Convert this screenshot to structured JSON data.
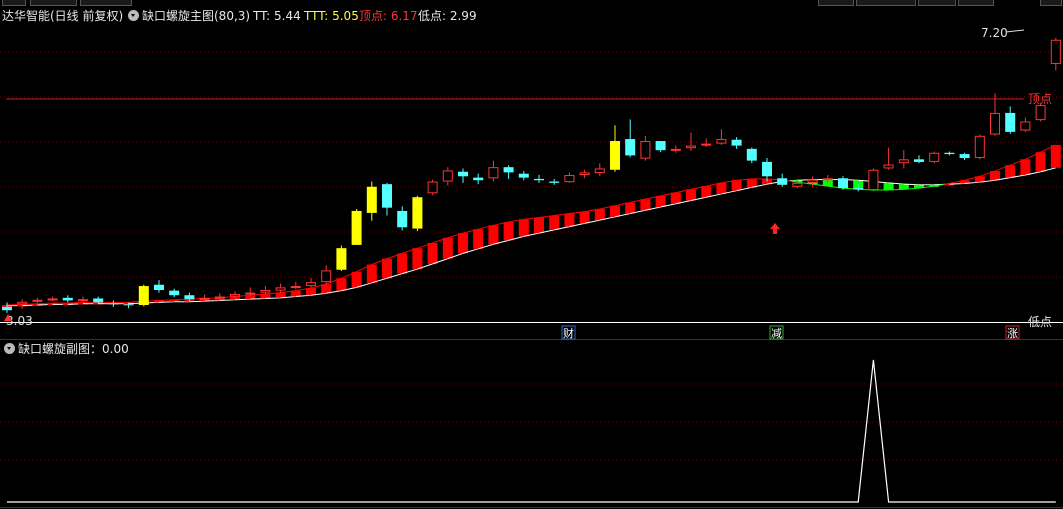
{
  "header": {
    "app_title": "达华智能(日线 前复权)",
    "indicator": "缺口螺旋主图(80,3)",
    "tt": "TT: 5.44",
    "ttt": "TTT: 5.05",
    "top_point": "顶点: 6.17",
    "low_point": "低点: 2.99"
  },
  "chart": {
    "max_label": "7.20",
    "min_label": "3.03",
    "top_line_label": "顶点",
    "low_line_label": "低点",
    "markers": [
      {
        "text": "财",
        "color": "#3366cc"
      },
      {
        "text": "减",
        "color": "#33aa33"
      },
      {
        "text": "涨",
        "color": "#cc2222"
      }
    ]
  },
  "sub_panel": {
    "title": "缺口螺旋副图",
    "value": "0.00"
  },
  "colors": {
    "up": "#ff3333",
    "down": "#54ffff",
    "limit": "#ffff00",
    "band_red": "#ff0000",
    "band_green": "#00ff00"
  },
  "chart_data": {
    "type": "candlestick",
    "candles": [
      [
        3.08,
        3.03,
        3.15,
        2.99
      ],
      [
        3.12,
        3.16,
        3.2,
        3.05
      ],
      [
        3.17,
        3.19,
        3.22,
        3.14
      ],
      [
        3.2,
        3.21,
        3.24,
        3.17
      ],
      [
        3.22,
        3.18,
        3.26,
        3.15
      ],
      [
        3.18,
        3.2,
        3.24,
        3.15
      ],
      [
        3.21,
        3.15,
        3.24,
        3.13
      ],
      [
        3.14,
        3.12,
        3.18,
        3.08
      ],
      [
        3.12,
        3.11,
        3.15,
        3.06
      ],
      [
        3.11,
        3.4,
        3.42,
        3.09
      ],
      [
        3.42,
        3.34,
        3.49,
        3.3
      ],
      [
        3.33,
        3.26,
        3.36,
        3.23
      ],
      [
        3.26,
        3.2,
        3.3,
        3.17
      ],
      [
        3.2,
        3.22,
        3.27,
        3.18
      ],
      [
        3.22,
        3.24,
        3.29,
        3.2
      ],
      [
        3.24,
        3.28,
        3.32,
        3.21
      ],
      [
        3.27,
        3.3,
        3.38,
        3.25
      ],
      [
        3.3,
        3.34,
        3.4,
        3.27
      ],
      [
        3.33,
        3.38,
        3.44,
        3.3
      ],
      [
        3.38,
        3.4,
        3.47,
        3.35
      ],
      [
        3.4,
        3.46,
        3.53,
        3.38
      ],
      [
        3.46,
        3.64,
        3.72,
        3.43
      ],
      [
        3.65,
        3.98,
        4.02,
        3.63
      ],
      [
        4.03,
        4.55,
        4.58,
        4.05
      ],
      [
        4.52,
        4.92,
        5.0,
        4.4
      ],
      [
        4.96,
        4.6,
        4.98,
        4.48
      ],
      [
        4.55,
        4.3,
        4.62,
        4.25
      ],
      [
        4.28,
        4.76,
        4.78,
        4.24
      ],
      [
        4.82,
        5.0,
        5.03,
        4.79
      ],
      [
        5.0,
        5.17,
        5.22,
        4.94
      ],
      [
        5.15,
        5.08,
        5.2,
        4.98
      ],
      [
        5.06,
        5.02,
        5.12,
        4.96
      ],
      [
        5.05,
        5.22,
        5.32,
        5.0
      ],
      [
        5.22,
        5.14,
        5.25,
        5.04
      ],
      [
        5.12,
        5.06,
        5.16,
        5.02
      ],
      [
        5.04,
        5.02,
        5.1,
        4.98
      ],
      [
        5.0,
        4.98,
        5.04,
        4.95
      ],
      [
        4.99,
        5.1,
        5.14,
        4.98
      ],
      [
        5.1,
        5.14,
        5.18,
        5.05
      ],
      [
        5.13,
        5.2,
        5.28,
        5.08
      ],
      [
        5.18,
        5.62,
        5.86,
        5.15
      ],
      [
        5.65,
        5.4,
        5.95,
        5.37
      ],
      [
        5.35,
        5.62,
        5.7,
        5.32
      ],
      [
        5.62,
        5.48,
        5.62,
        5.45
      ],
      [
        5.49,
        5.5,
        5.55,
        5.44
      ],
      [
        5.51,
        5.55,
        5.75,
        5.47
      ],
      [
        5.56,
        5.58,
        5.66,
        5.53
      ],
      [
        5.58,
        5.65,
        5.8,
        5.56
      ],
      [
        5.64,
        5.55,
        5.68,
        5.5
      ],
      [
        5.5,
        5.32,
        5.52,
        5.28
      ],
      [
        5.3,
        5.08,
        5.36,
        5.0
      ],
      [
        5.05,
        4.95,
        5.12,
        4.92
      ],
      [
        4.92,
        4.98,
        5.04,
        4.9
      ],
      [
        4.98,
        5.03,
        5.08,
        4.92
      ],
      [
        5.02,
        5.05,
        5.1,
        4.98
      ],
      [
        5.05,
        4.9,
        5.08,
        4.87
      ],
      [
        4.9,
        4.88,
        4.96,
        4.85
      ],
      [
        4.87,
        5.18,
        5.2,
        4.85
      ],
      [
        5.2,
        5.26,
        5.52,
        5.18
      ],
      [
        5.28,
        5.34,
        5.48,
        5.2
      ],
      [
        5.34,
        5.3,
        5.4,
        5.28
      ],
      [
        5.3,
        5.44,
        5.46,
        5.28
      ],
      [
        5.44,
        5.42,
        5.46,
        5.4
      ],
      [
        5.42,
        5.36,
        5.44,
        5.33
      ],
      [
        5.36,
        5.7,
        5.72,
        5.34
      ],
      [
        5.72,
        6.05,
        6.35,
        5.7
      ],
      [
        6.05,
        5.76,
        6.15,
        5.73
      ],
      [
        5.78,
        5.92,
        5.98,
        5.76
      ],
      [
        5.94,
        6.17,
        6.2,
        5.92
      ],
      [
        6.8,
        7.17,
        7.2,
        6.7
      ]
    ],
    "band": [
      [
        3.1,
        3.11
      ],
      [
        3.1,
        3.12
      ],
      [
        3.11,
        3.13
      ],
      [
        3.12,
        3.14
      ],
      [
        3.12,
        3.14
      ],
      [
        3.13,
        3.15
      ],
      [
        3.13,
        3.15
      ],
      [
        3.13,
        3.15
      ],
      [
        3.13,
        3.15
      ],
      [
        3.14,
        3.17
      ],
      [
        3.15,
        3.18
      ],
      [
        3.16,
        3.19
      ],
      [
        3.16,
        3.2
      ],
      [
        3.17,
        3.21
      ],
      [
        3.18,
        3.22
      ],
      [
        3.19,
        3.24
      ],
      [
        3.2,
        3.26
      ],
      [
        3.21,
        3.28
      ],
      [
        3.22,
        3.3
      ],
      [
        3.24,
        3.33
      ],
      [
        3.26,
        3.37
      ],
      [
        3.29,
        3.43
      ],
      [
        3.33,
        3.52
      ],
      [
        3.38,
        3.62
      ],
      [
        3.45,
        3.73
      ],
      [
        3.52,
        3.82
      ],
      [
        3.59,
        3.9
      ],
      [
        3.66,
        3.98
      ],
      [
        3.74,
        4.06
      ],
      [
        3.82,
        4.14
      ],
      [
        3.9,
        4.21
      ],
      [
        3.97,
        4.27
      ],
      [
        4.04,
        4.33
      ],
      [
        4.1,
        4.38
      ],
      [
        4.16,
        4.42
      ],
      [
        4.21,
        4.45
      ],
      [
        4.26,
        4.48
      ],
      [
        4.31,
        4.51
      ],
      [
        4.36,
        4.54
      ],
      [
        4.41,
        4.58
      ],
      [
        4.46,
        4.63
      ],
      [
        4.51,
        4.68
      ],
      [
        4.56,
        4.73
      ],
      [
        4.61,
        4.78
      ],
      [
        4.66,
        4.83
      ],
      [
        4.71,
        4.88
      ],
      [
        4.76,
        4.93
      ],
      [
        4.81,
        4.98
      ],
      [
        4.86,
        5.02
      ],
      [
        4.91,
        5.04
      ],
      [
        4.96,
        5.04
      ],
      [
        5.0,
        5.02
      ],
      [
        5.02,
        4.99
      ],
      [
        5.03,
        4.96
      ],
      [
        5.03,
        4.93
      ],
      [
        5.03,
        4.9
      ],
      [
        5.02,
        4.88
      ],
      [
        5.0,
        4.87
      ],
      [
        4.98,
        4.87
      ],
      [
        4.96,
        4.88
      ],
      [
        4.95,
        4.9
      ],
      [
        4.95,
        4.93
      ],
      [
        4.96,
        4.97
      ],
      [
        4.97,
        5.02
      ],
      [
        4.99,
        5.08
      ],
      [
        5.02,
        5.16
      ],
      [
        5.06,
        5.25
      ],
      [
        5.1,
        5.34
      ],
      [
        5.15,
        5.45
      ],
      [
        5.21,
        5.56
      ]
    ],
    "subchart": {
      "values": [
        0,
        0,
        0,
        0,
        0,
        0,
        0,
        0,
        0,
        0,
        0,
        0,
        0,
        0,
        0,
        0,
        0,
        0,
        0,
        0,
        0,
        0,
        0,
        0,
        0,
        0,
        0,
        0,
        0,
        0,
        0,
        0,
        0,
        0,
        0,
        0,
        0,
        0,
        0,
        0,
        0,
        0,
        0,
        0,
        0,
        0,
        0,
        0,
        0,
        0,
        0,
        0,
        0,
        0,
        0,
        0,
        0,
        1,
        0,
        0,
        0,
        0,
        0,
        0,
        0,
        0,
        0,
        0,
        0,
        0
      ]
    },
    "ylim": [
      2.85,
      7.35
    ],
    "top_value": 6.17,
    "low_value": 2.99
  }
}
